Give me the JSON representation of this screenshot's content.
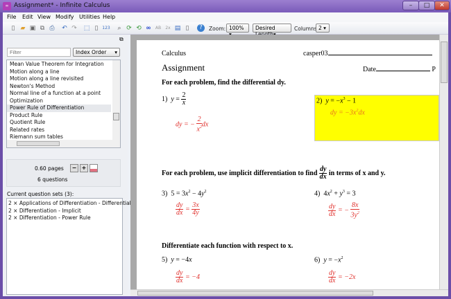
{
  "window": {
    "title": "Assignment* - Infinite Calculus",
    "app_icon": "infinity-logo",
    "controls": [
      "minimize",
      "maximize",
      "close"
    ]
  },
  "menu": [
    "File",
    "Edit",
    "View",
    "Modify",
    "Utilities",
    "Help"
  ],
  "toolbar": {
    "icons": [
      "new-icon",
      "open-icon",
      "save-icon",
      "save-as-icon",
      "print-icon",
      "undo-icon",
      "redo-icon",
      "select-icon",
      "page-icon",
      "numbering-icon",
      "search-icon",
      "regenerate-icon",
      "regenerate-all-icon",
      "infinity-icon",
      "choices-icon",
      "formula-icon",
      "comment-icon",
      "column-icon",
      "help-icon"
    ],
    "numbering_label": "123",
    "zoom_label": "Zoom:",
    "zoom_value": "100%",
    "length_value": "Desired Length",
    "columns_label": "Columns:",
    "columns_value": "2"
  },
  "left": {
    "filter_placeholder": "Filter",
    "order_value": "Index Order",
    "topics": [
      "Mean Value Theorem for Integration",
      "Motion along a line",
      "Motion along a line revisited",
      "Newton's Method",
      "Normal line of a function at a point",
      "Optimization",
      "Power Rule of Differentiation",
      "Product Rule",
      "Quotient Rule",
      "Related rates",
      "Riemann sum tables"
    ],
    "selected_topic": "Power Rule of Differentiation",
    "pages": "0.60 pages",
    "questions": "6 questions",
    "sets_label": "Current question sets (3):",
    "sets": [
      "2 × Applications of Differentiation - Differential",
      "2 × Differentiation - Implicit",
      "2 × Differentiation - Power Rule"
    ]
  },
  "doc": {
    "course": "Calculus",
    "name": "casper03",
    "title": "Assignment",
    "date_label": "Date",
    "period_label": "P",
    "sec1": "For each problem, find the differential dy.",
    "q1": "1)",
    "q2": "2)",
    "sec2a": "For each problem, use implicit differentiation to find",
    "sec2b": "in terms of x and y.",
    "q3": "3)",
    "q4": "4)",
    "sec3": "Differentiate each function with respect to x.",
    "q5": "5)",
    "q6": "6)",
    "highlight_color": "#ffff00",
    "answer_color": "#e0302c"
  }
}
